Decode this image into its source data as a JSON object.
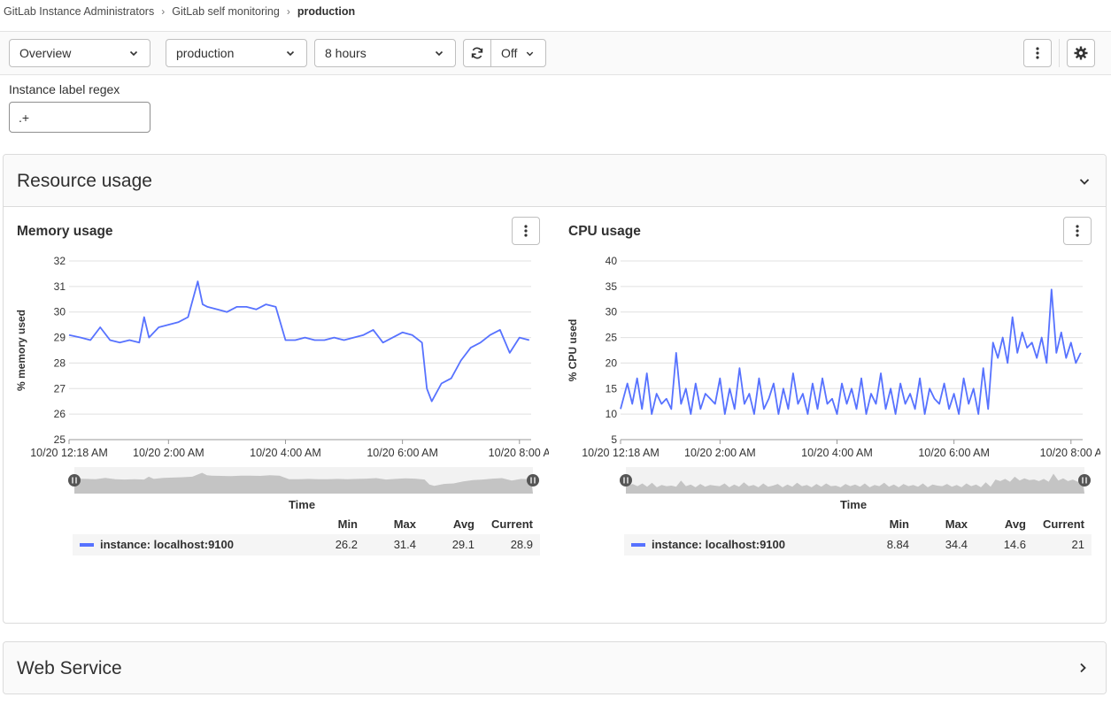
{
  "breadcrumb": {
    "items": [
      "GitLab Instance Administrators",
      "GitLab self monitoring",
      "production"
    ]
  },
  "toolbar": {
    "dashboard": "Overview",
    "environment": "production",
    "time_range": "8 hours",
    "refresh_interval": "Off"
  },
  "variables": {
    "regex_label": "Instance label regex",
    "regex_value": ".+"
  },
  "panels": {
    "resource": {
      "title": "Resource usage",
      "expanded": true
    },
    "web": {
      "title": "Web Service",
      "expanded": false
    }
  },
  "legend_headers": {
    "min": "Min",
    "max": "Max",
    "avg": "Avg",
    "current": "Current"
  },
  "charts": {
    "memory": {
      "name": "instance: localhost:9100",
      "min": "26.2",
      "max": "31.4",
      "avg": "29.1",
      "current": "28.9"
    },
    "cpu": {
      "name": "instance: localhost:9100",
      "min": "8.84",
      "max": "34.4",
      "avg": "14.6",
      "current": "21"
    }
  },
  "colors": {
    "series": "#5772ff",
    "grid": "#e0e0e0",
    "brush": "#c4c4c4"
  },
  "icons": [
    "chevron-down-icon",
    "retry-icon",
    "ellipsis-v-icon",
    "settings-icon",
    "chevron-right-icon"
  ],
  "chart_data": [
    {
      "type": "line",
      "title": "Memory usage",
      "xlabel": "Time",
      "ylabel": "% memory used",
      "ylim": [
        25,
        32
      ],
      "yticks": [
        25,
        26,
        27,
        28,
        29,
        30,
        31,
        32
      ],
      "xticks": [
        "10/20 12:18 AM",
        "10/20 2:00 AM",
        "10/20 4:00 AM",
        "10/20 6:00 AM",
        "10/20 8:00 A"
      ],
      "grid": true,
      "series": [
        {
          "name": "instance: localhost:9100",
          "x": [
            "00:18",
            "00:30",
            "00:40",
            "00:50",
            "01:00",
            "01:10",
            "01:20",
            "01:30",
            "01:35",
            "01:40",
            "01:50",
            "02:00",
            "02:10",
            "02:20",
            "02:30",
            "02:35",
            "02:40",
            "02:50",
            "03:00",
            "03:10",
            "03:20",
            "03:30",
            "03:40",
            "03:50",
            "04:00",
            "04:10",
            "04:20",
            "04:30",
            "04:40",
            "04:50",
            "05:00",
            "05:10",
            "05:20",
            "05:30",
            "05:40",
            "05:50",
            "06:00",
            "06:10",
            "06:20",
            "06:25",
            "06:30",
            "06:40",
            "06:50",
            "07:00",
            "07:10",
            "07:20",
            "07:30",
            "07:40",
            "07:50",
            "08:00",
            "08:10"
          ],
          "values": [
            29.1,
            29.0,
            28.9,
            29.4,
            28.9,
            28.8,
            28.9,
            28.8,
            29.8,
            29.0,
            29.4,
            29.5,
            29.6,
            29.8,
            31.2,
            30.3,
            30.2,
            30.1,
            30.0,
            30.2,
            30.2,
            30.1,
            30.3,
            30.2,
            28.9,
            28.9,
            29.0,
            28.9,
            28.9,
            29.0,
            28.9,
            29.0,
            29.1,
            29.3,
            28.8,
            29.0,
            29.2,
            29.1,
            28.8,
            27.0,
            26.5,
            27.2,
            27.4,
            28.1,
            28.6,
            28.8,
            29.1,
            29.3,
            28.4,
            29.0,
            28.9
          ]
        }
      ]
    },
    {
      "type": "line",
      "title": "CPU usage",
      "xlabel": "Time",
      "ylabel": "% CPU used",
      "ylim": [
        5,
        40
      ],
      "yticks": [
        5,
        10,
        15,
        20,
        25,
        30,
        35,
        40
      ],
      "xticks": [
        "10/20 12:18 AM",
        "10/20 2:00 AM",
        "10/20 4:00 AM",
        "10/20 6:00 AM",
        "10/20 8:00 A"
      ],
      "grid": true,
      "series": [
        {
          "name": "instance: localhost:9100",
          "x": [
            "00:18",
            "00:25",
            "00:30",
            "00:35",
            "00:40",
            "00:45",
            "00:50",
            "00:55",
            "01:00",
            "01:05",
            "01:10",
            "01:15",
            "01:20",
            "01:25",
            "01:30",
            "01:35",
            "01:40",
            "01:45",
            "01:50",
            "01:55",
            "02:00",
            "02:05",
            "02:10",
            "02:15",
            "02:20",
            "02:25",
            "02:30",
            "02:35",
            "02:40",
            "02:45",
            "02:50",
            "02:55",
            "03:00",
            "03:05",
            "03:10",
            "03:15",
            "03:20",
            "03:25",
            "03:30",
            "03:35",
            "03:40",
            "03:45",
            "03:50",
            "03:55",
            "04:00",
            "04:05",
            "04:10",
            "04:15",
            "04:20",
            "04:25",
            "04:30",
            "04:35",
            "04:40",
            "04:45",
            "04:50",
            "04:55",
            "05:00",
            "05:05",
            "05:10",
            "05:15",
            "05:20",
            "05:25",
            "05:30",
            "05:35",
            "05:40",
            "05:45",
            "05:50",
            "05:55",
            "06:00",
            "06:05",
            "06:10",
            "06:15",
            "06:20",
            "06:25",
            "06:30",
            "06:35",
            "06:40",
            "06:45",
            "06:50",
            "06:55",
            "07:00",
            "07:05",
            "07:10",
            "07:15",
            "07:20",
            "07:25",
            "07:30",
            "07:35",
            "07:40",
            "07:45",
            "07:50",
            "07:55",
            "08:00",
            "08:05",
            "08:10"
          ],
          "values": [
            11,
            16,
            12,
            17,
            11,
            18,
            10,
            14,
            12,
            13,
            11,
            22,
            12,
            15,
            10,
            16,
            11,
            14,
            13,
            12,
            17,
            10,
            15,
            11,
            19,
            12,
            14,
            10,
            17,
            11,
            13,
            16,
            10,
            15,
            11,
            18,
            12,
            14,
            10,
            16,
            11,
            17,
            12,
            13,
            10,
            16,
            12,
            15,
            11,
            17,
            10,
            14,
            12,
            18,
            11,
            15,
            10,
            16,
            12,
            14,
            11,
            17,
            10,
            15,
            13,
            12,
            16,
            11,
            14,
            10,
            17,
            12,
            15,
            10,
            19,
            11,
            24,
            21,
            25,
            20,
            29,
            22,
            26,
            23,
            24,
            21,
            25,
            20,
            34.4,
            22,
            26,
            21,
            24,
            20,
            22
          ]
        }
      ]
    }
  ]
}
